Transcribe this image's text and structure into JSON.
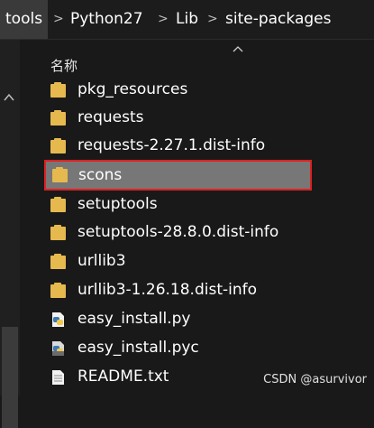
{
  "breadcrumb": {
    "segments": [
      "tools",
      "Python27",
      "Lib",
      "site-packages"
    ]
  },
  "file_list": {
    "column_header": "名称",
    "items": [
      {
        "name": "pkg_resources",
        "type": "folder"
      },
      {
        "name": "requests",
        "type": "folder"
      },
      {
        "name": "requests-2.27.1.dist-info",
        "type": "folder"
      },
      {
        "name": "scons",
        "type": "folder",
        "selected": true
      },
      {
        "name": "setuptools",
        "type": "folder"
      },
      {
        "name": "setuptools-28.8.0.dist-info",
        "type": "folder"
      },
      {
        "name": "urllib3",
        "type": "folder"
      },
      {
        "name": "urllib3-1.26.18.dist-info",
        "type": "folder"
      },
      {
        "name": "easy_install.py",
        "type": "python-file"
      },
      {
        "name": "easy_install.pyc",
        "type": "python-compiled-file"
      },
      {
        "name": "README.txt",
        "type": "text-file"
      }
    ]
  },
  "watermark": "CSDN @asurvivor",
  "colors": {
    "folder": "#e6b94f",
    "selection_border": "#e02020",
    "selection_fill": "#777777"
  }
}
